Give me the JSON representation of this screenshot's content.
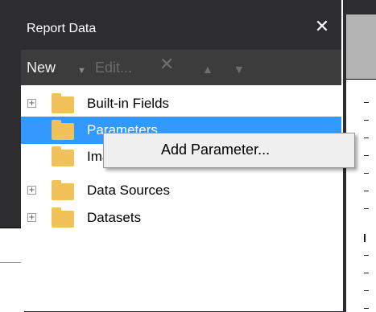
{
  "panel": {
    "title": "Report Data",
    "close_glyph": "✕"
  },
  "toolbar": {
    "new_label": "New",
    "new_arrow": "▼",
    "edit_label": "Edit...",
    "delete_glyph": "✕",
    "up_glyph": "▲",
    "down_glyph": "▼"
  },
  "tree": {
    "items": [
      {
        "label": "Built-in Fields",
        "expandable": true
      },
      {
        "label": "Parameters",
        "expandable": false,
        "selected": true
      },
      {
        "label": "Images",
        "expandable": false
      },
      {
        "label": "Data Sources",
        "expandable": true
      },
      {
        "label": "Datasets",
        "expandable": true
      }
    ],
    "expand_glyph": "+"
  },
  "context_menu": {
    "items": [
      {
        "label": "Add Parameter..."
      }
    ]
  },
  "colors": {
    "selection": "#3399ff",
    "folder": "#f2c25a",
    "titlebar": "#2d2d30",
    "toolbar": "#3c3c3c"
  }
}
